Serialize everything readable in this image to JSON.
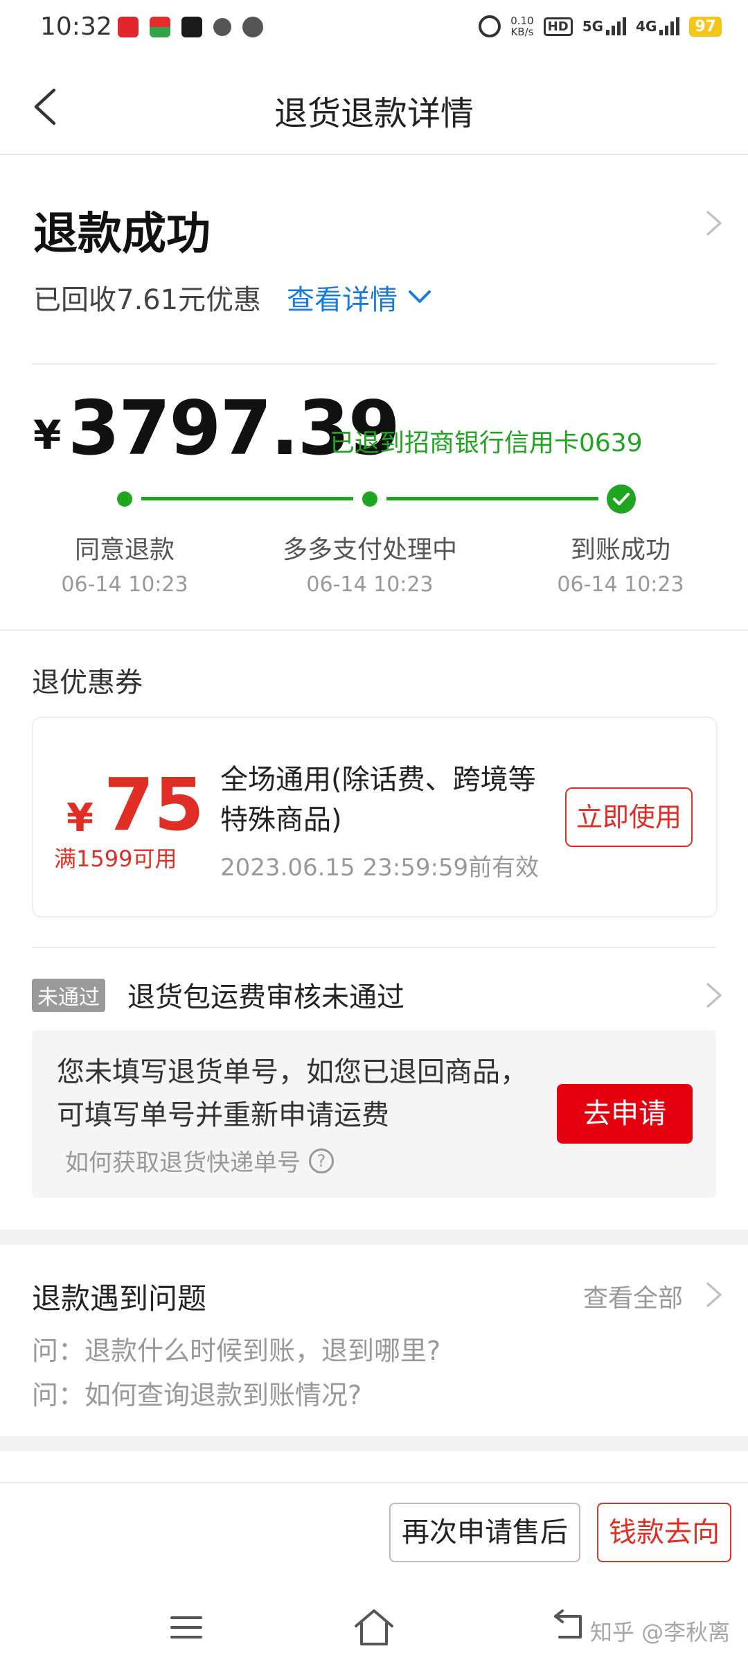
{
  "status_bar": {
    "time": "10:32",
    "net_speed_value": "0.10",
    "net_speed_unit": "KB/s",
    "hd": "HD",
    "sig1": "5G",
    "sig2": "4G",
    "battery": "97"
  },
  "nav": {
    "title": "退货退款详情",
    "back_icon": "back-chevron-icon"
  },
  "status": {
    "title": "退款成功",
    "recovered_text": "已回收7.61元优惠",
    "detail_link": "查看详情"
  },
  "amount": {
    "currency": "¥",
    "value": "3797.39",
    "destination": "已退到招商银行信用卡0639"
  },
  "progress": {
    "steps": [
      {
        "label": "同意退款",
        "time": "06-14 10:23"
      },
      {
        "label": "多多支付处理中",
        "time": "06-14 10:23"
      },
      {
        "label": "到账成功",
        "time": "06-14 10:23"
      }
    ]
  },
  "coupon_section": {
    "label": "退优惠券",
    "coupon": {
      "currency": "¥",
      "amount": "75",
      "condition": "满1599可用",
      "description": "全场通用(除话费、跨境等特殊商品)",
      "validity": "2023.06.15 23:59:59前有效",
      "use_button": "立即使用"
    }
  },
  "shipping_fee": {
    "badge": "未通过",
    "title": "退货包运费审核未通过",
    "message": "您未填写退货单号，如您已退回商品，可填写单号并重新申请运费",
    "help_text": "如何获取退货快递单号",
    "help_icon_glyph": "?",
    "apply_button": "去申请"
  },
  "faq": {
    "title": "退款遇到问题",
    "view_all": "查看全部",
    "questions": [
      "问：退款什么时候到账，退到哪里?",
      "问：如何查询退款到账情况?"
    ]
  },
  "bottom_actions": {
    "reapply": "再次申请售后",
    "money_flow": "钱款去向"
  },
  "watermark": "知乎 @李秋离",
  "colors": {
    "accent_red": "#e02e24",
    "apply_red": "#e4000f",
    "success_green": "#1fa51f",
    "link_blue": "#1a7ad9"
  }
}
